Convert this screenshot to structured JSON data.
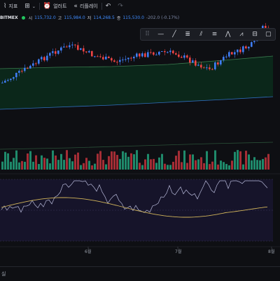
{
  "toolbar": {
    "indicators_label": "지표",
    "alerts_label": "얼러트",
    "replay_label": "리플레이"
  },
  "legend": {
    "symbol": "BITMEX",
    "open_label": "시",
    "open_value": "115,732.0",
    "high_label": "고",
    "high_value": "115,984.0",
    "low_label": "저",
    "low_value": "114,268.5",
    "close_label": "종",
    "close_value": "115,530.0",
    "change": "-202.0 (-0.17%)"
  },
  "x_axis": {
    "labels": [
      "6월",
      "7월",
      "8월"
    ]
  },
  "bottom": {
    "left_text": "실"
  },
  "colors": {
    "up": "#3f7df5",
    "down": "#ef4444",
    "vol_up": "#1f8a6b",
    "vol_down": "#a52d35",
    "rsi": "#b7b9d9",
    "rsi_ma": "#d1b45a"
  },
  "icons": [
    "indicators-icon",
    "layout-icon",
    "alert-icon",
    "replay-icon",
    "undo-icon",
    "redo-icon",
    "drawing-tools"
  ]
}
